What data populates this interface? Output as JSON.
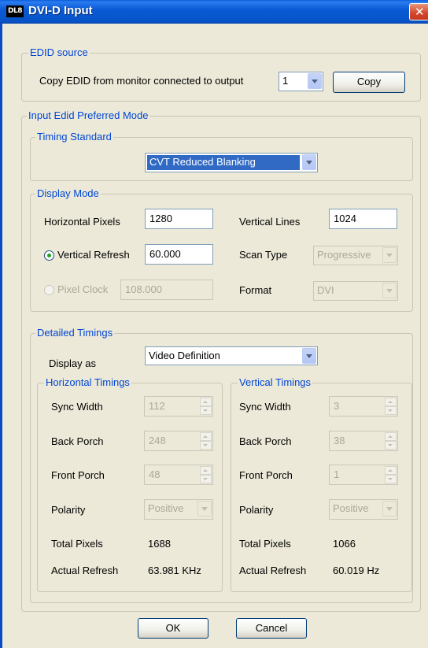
{
  "window": {
    "app_icon_text": "DL8",
    "title": "DVI-D Input",
    "close_glyph": "✕"
  },
  "edid_source": {
    "legend": "EDID source",
    "copy_label": "Copy EDID from monitor connected to output",
    "output_value": "1",
    "copy_button": "Copy"
  },
  "preferred_mode": {
    "legend": "Input Edid Preferred Mode",
    "timing_standard": {
      "legend": "Timing Standard",
      "value": "CVT Reduced Blanking"
    },
    "display_mode": {
      "legend": "Display Mode",
      "horizontal_pixels_label": "Horizontal Pixels",
      "horizontal_pixels_value": "1280",
      "vertical_lines_label": "Vertical Lines",
      "vertical_lines_value": "1024",
      "vertical_refresh_label": "Vertical Refresh",
      "vertical_refresh_value": "60.000",
      "scan_type_label": "Scan Type",
      "scan_type_value": "Progressive",
      "pixel_clock_label": "Pixel Clock",
      "pixel_clock_value": "108.000",
      "format_label": "Format",
      "format_value": "DVI"
    },
    "detailed_timings": {
      "legend": "Detailed Timings",
      "display_as_label": "Display as",
      "display_as_value": "Video Definition",
      "horizontal": {
        "legend": "Horizontal Timings",
        "sync_width_label": "Sync Width",
        "sync_width_value": "112",
        "back_porch_label": "Back Porch",
        "back_porch_value": "248",
        "front_porch_label": "Front Porch",
        "front_porch_value": "48",
        "polarity_label": "Polarity",
        "polarity_value": "Positive",
        "total_pixels_label": "Total Pixels",
        "total_pixels_value": "1688",
        "actual_refresh_label": "Actual Refresh",
        "actual_refresh_value": "63.981 KHz"
      },
      "vertical": {
        "legend": "Vertical Timings",
        "sync_width_label": "Sync Width",
        "sync_width_value": "3",
        "back_porch_label": "Back Porch",
        "back_porch_value": "38",
        "front_porch_label": "Front Porch",
        "front_porch_value": "1",
        "polarity_label": "Polarity",
        "polarity_value": "Positive",
        "total_pixels_label": "Total Pixels",
        "total_pixels_value": "1066",
        "actual_refresh_label": "Actual Refresh",
        "actual_refresh_value": "60.019 Hz"
      }
    }
  },
  "footer": {
    "ok_button": "OK",
    "cancel_button": "Cancel"
  },
  "colors": {
    "title_bar": "#0A5AD6",
    "legend_text": "#0046D5",
    "dialog_bg": "#ECE9D8",
    "close_button": "#D5452B",
    "selection": "#316AC5",
    "radio_dot": "#21A121"
  }
}
